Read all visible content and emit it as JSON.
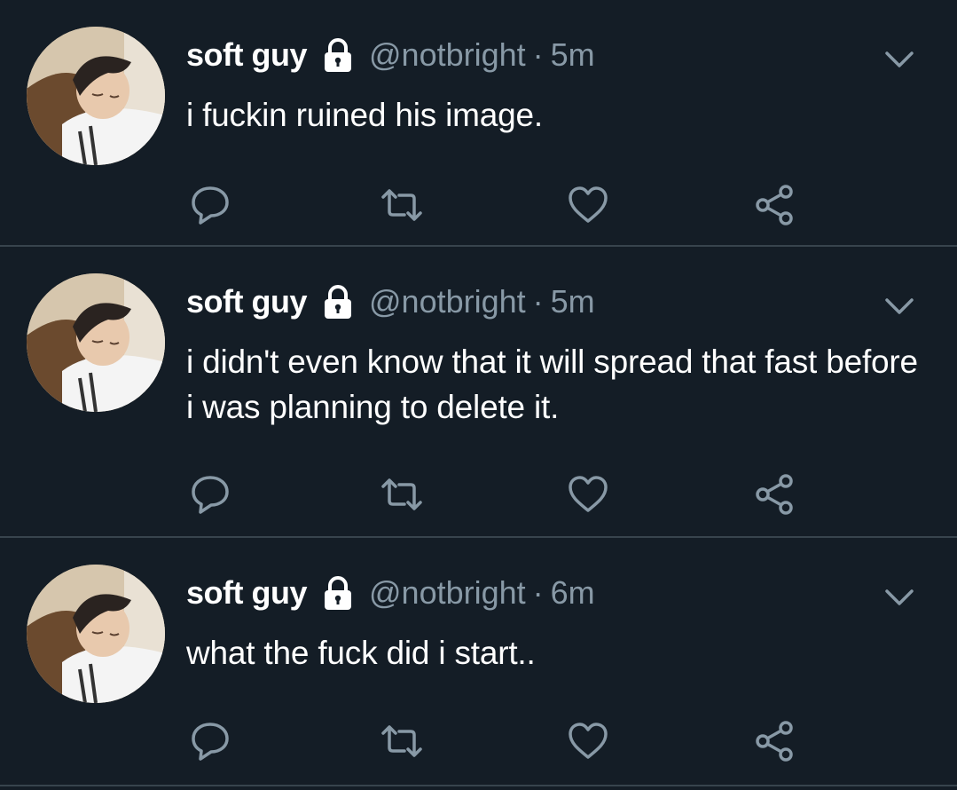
{
  "colors": {
    "background": "#141d26",
    "divider": "#38444d",
    "secondary_text": "#8899a6",
    "primary_text": "#ffffff"
  },
  "icons": {
    "reply": "reply-icon",
    "retweet": "retweet-icon",
    "like": "heart-icon",
    "share": "share-icon",
    "protected": "lock-icon",
    "menu": "chevron-down-icon"
  },
  "tweets": [
    {
      "display_name": "soft guy",
      "handle": "@notbright",
      "separator": "·",
      "time": "5m",
      "text": "i fuckin ruined his image."
    },
    {
      "display_name": "soft guy",
      "handle": "@notbright",
      "separator": "·",
      "time": "5m",
      "text": "i didn't even know that it will spread that fast before i was planning to delete it."
    },
    {
      "display_name": "soft guy",
      "handle": "@notbright",
      "separator": "·",
      "time": "6m",
      "text": "what the fuck did i start.."
    }
  ]
}
